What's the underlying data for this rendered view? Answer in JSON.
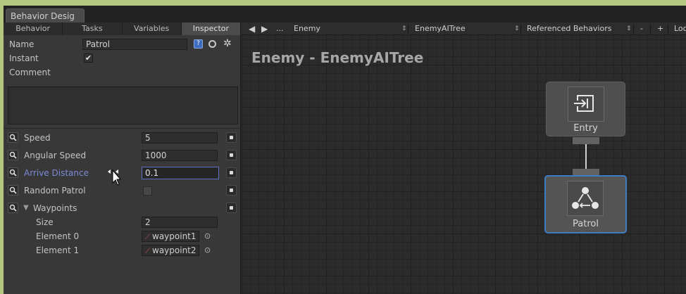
{
  "window": {
    "tab_title": "Behavior Desig"
  },
  "panel_tabs": [
    "Behavior",
    "Tasks",
    "Variables",
    "Inspector"
  ],
  "inspector": {
    "name_label": "Name",
    "name_value": "Patrol",
    "instant_label": "Instant",
    "instant_checked": "✔",
    "comment_label": "Comment",
    "properties": [
      {
        "label": "Speed",
        "value": "5"
      },
      {
        "label": "Angular Speed",
        "value": "1000"
      },
      {
        "label": "Arrive Distance",
        "value": "0.1"
      },
      {
        "label": "Random Patrol",
        "value": ""
      },
      {
        "label": "Waypoints",
        "value": ""
      }
    ],
    "waypoints": {
      "arrow": "▼",
      "size_label": "Size",
      "size_value": "2",
      "elements": [
        {
          "label": "Element 0",
          "value": "waypoint1"
        },
        {
          "label": "Element 1",
          "value": "waypoint2"
        }
      ]
    }
  },
  "toolbar": {
    "prev": "◀",
    "next": "▶",
    "ellipsis": "...",
    "object": "Enemy",
    "tree": "EnemyAITree",
    "referenced": "Referenced Behaviors",
    "minus": "-",
    "plus": "+",
    "lock": "Loc"
  },
  "graph": {
    "title": "Enemy - EnemyAITree",
    "nodes": [
      {
        "label": "Entry"
      },
      {
        "label": "Patrol"
      }
    ]
  },
  "colors": {
    "focus_border": "#5e6fc4",
    "highlight_label": "#7d8ad6",
    "selected_node": "#3e7cc4"
  }
}
